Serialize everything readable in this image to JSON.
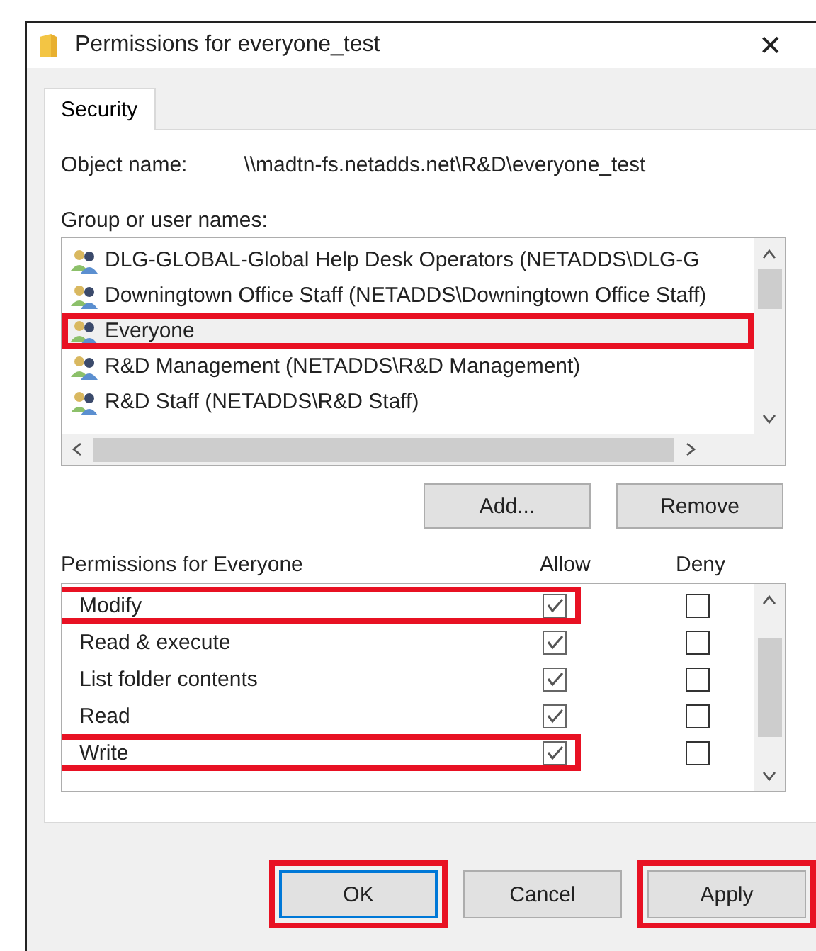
{
  "window": {
    "title": "Permissions for everyone_test",
    "close": "✕"
  },
  "tabs": [
    {
      "label": "Security",
      "selected": true
    }
  ],
  "object_name": {
    "label": "Object name:",
    "value": "\\\\madtn-fs.netadds.net\\R&D\\everyone_test"
  },
  "groups": {
    "label": "Group or user names:",
    "items": [
      {
        "name": "DLG-GLOBAL-Global Help Desk Operators (NETADDS\\DLG-G",
        "selected": false,
        "highlighted": false
      },
      {
        "name": "Downingtown Office Staff (NETADDS\\Downingtown Office Staff)",
        "selected": false,
        "highlighted": false
      },
      {
        "name": "Everyone",
        "selected": true,
        "highlighted": true
      },
      {
        "name": "R&D Management (NETADDS\\R&D Management)",
        "selected": false,
        "highlighted": false
      },
      {
        "name": "R&D Staff (NETADDS\\R&D Staff)",
        "selected": false,
        "highlighted": false
      }
    ],
    "buttons": [
      "Add...",
      "Remove"
    ]
  },
  "permissions": {
    "label": "Permissions for Everyone",
    "allow_header": "Allow",
    "deny_header": "Deny",
    "rows": [
      {
        "name": "Modify",
        "allow": true,
        "deny": false,
        "highlighted": true
      },
      {
        "name": "Read & execute",
        "allow": true,
        "deny": false,
        "highlighted": false
      },
      {
        "name": "List folder contents",
        "allow": true,
        "deny": false,
        "highlighted": false
      },
      {
        "name": "Read",
        "allow": true,
        "deny": false,
        "highlighted": false
      },
      {
        "name": "Write",
        "allow": true,
        "deny": false,
        "highlighted": true
      }
    ]
  },
  "buttons": [
    {
      "label": "OK",
      "default": true,
      "highlighted": true
    },
    {
      "label": "Cancel",
      "default": false,
      "highlighted": false
    },
    {
      "label": "Apply",
      "default": false,
      "highlighted": true
    }
  ]
}
